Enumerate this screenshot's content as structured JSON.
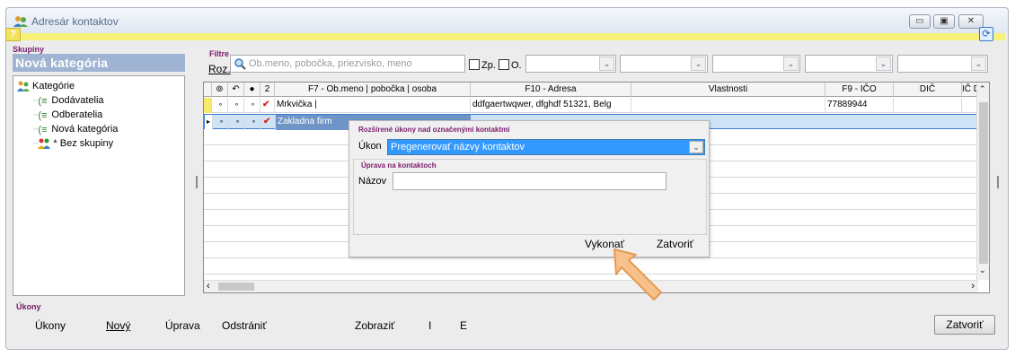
{
  "window": {
    "title": "Adresár kontaktov"
  },
  "left": {
    "groups_label": "Skupiny",
    "current_category": "Nová kategória",
    "tree": [
      {
        "label": "Kategórie",
        "icon": "people-icon",
        "level": 0
      },
      {
        "label": "Dodávatelia",
        "icon": "list-icon",
        "level": 1
      },
      {
        "label": "Odberatelia",
        "icon": "list-icon",
        "level": 1
      },
      {
        "label": "Nová kategória",
        "icon": "list-icon",
        "level": 1
      },
      {
        "label": "* Bez skupiny",
        "icon": "people-color-icon",
        "level": 1
      }
    ]
  },
  "filters": {
    "label": "Filtre",
    "roz_label": "Roz.",
    "search_placeholder": "Ob.meno, pobočka, priezvisko, meno",
    "zp_label": "Zp.",
    "o_label": "O."
  },
  "grid": {
    "headers": [
      "",
      "",
      "",
      "2",
      "F7 - Ob.meno | pobočka | osoba",
      "F10 - Adresa",
      "Vlastnosti",
      "F9 - IČO",
      "DIČ",
      "IČ D"
    ],
    "rows": [
      {
        "name": "Mrkvička |",
        "address": "ddfgaertwqwer, dfghdf 51321, Belg",
        "ico": "77889944",
        "selected": false
      },
      {
        "name": "Zakladna firm",
        "address": "",
        "ico": "",
        "selected": true
      }
    ]
  },
  "popup": {
    "title": "Rozšírené úkony nad označenými kontaktmi",
    "ukon_label": "Úkon",
    "ukon_value": "Pregenerovať názvy kontaktov",
    "group_title": "Úprava na kontaktoch",
    "nazov_label": "Názov",
    "execute_label": "Vykonať",
    "close_label": "Zatvoriť"
  },
  "bottom": {
    "label": "Úkony",
    "buttons": [
      "Úkony",
      "Nový",
      "Úprava",
      "Odstrániť",
      "Zobraziť",
      "I",
      "E"
    ],
    "close_label": "Zatvoriť"
  },
  "colors": {
    "accent": "#9fb4d3",
    "highlight": "#3399ff",
    "yellowbar": "#f7f17a",
    "arrow": "#f5b57a"
  }
}
